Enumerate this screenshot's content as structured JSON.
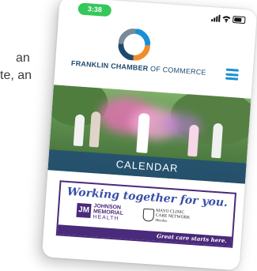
{
  "background_text": {
    "line1": "an",
    "line2": "te, an"
  },
  "status_bar": {
    "time": "3:38",
    "icons": [
      "signal-icon",
      "wifi-icon",
      "battery-icon"
    ],
    "time_pill_color": "#34c759"
  },
  "header": {
    "brand_bold": "FRANKLIN CHAMBER",
    "brand_light": " OF COMMERCE",
    "menu_icon": "hamburger-menu-icon",
    "logo_colors": [
      "#1a8fd6",
      "#f28c28",
      "#1e4a6e",
      "#7a8a99"
    ]
  },
  "hero": {
    "label": "CALENDAR"
  },
  "ad": {
    "title": "Working together for you.",
    "johnson_logo": "JM",
    "johnson_line1": "JOHNSON",
    "johnson_line2": "MEMORIAL",
    "johnson_line3": "HEALTH",
    "mayo_line1": "MAYO CLINIC",
    "mayo_line2": "CARE NETWORK",
    "mayo_line3": "Member",
    "footer": "Great care starts here."
  }
}
